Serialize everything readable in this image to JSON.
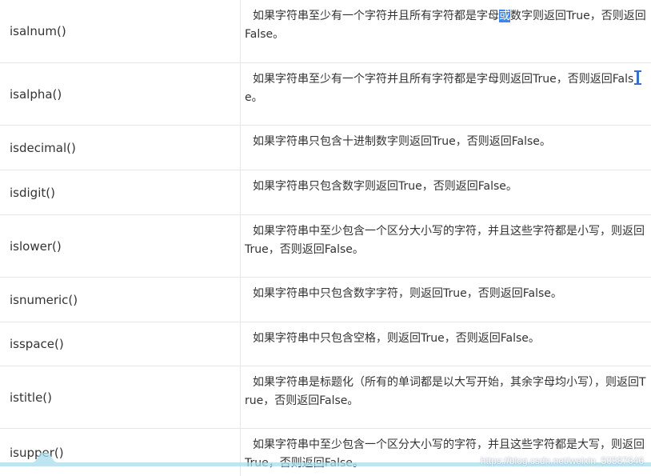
{
  "rows": [
    {
      "method": "isalnum()",
      "desc_before": "如果字符串至少有一个字符并且所有字符都是字母",
      "desc_highlight": "或",
      "desc_after": "数字则返回True，否则返回False。"
    },
    {
      "method": "isalpha()",
      "desc_before": "如果字符串至少有一个字符并且所有字符都是字母则返回True，否则返回Fals",
      "desc_after": "e。"
    },
    {
      "method": "isdecimal()",
      "desc": "如果字符串只包含十进制数字则返回True，否则返回False。"
    },
    {
      "method": "isdigit()",
      "desc": "如果字符串只包含数字则返回True，否则返回False。"
    },
    {
      "method": "islower()",
      "desc": "如果字符串中至少包含一个区分大小写的字符，并且这些字符都是小写，则返回True，否则返回False。"
    },
    {
      "method": "isnumeric()",
      "desc": "如果字符串中只包含数字字符，则返回True，否则返回False。"
    },
    {
      "method": "isspace()",
      "desc": "如果字符串中只包含空格，则返回True，否则返回False。"
    },
    {
      "method": "istitle()",
      "desc": "如果字符串是标题化（所有的单词都是以大写开始，其余字母均小写），则返回True，否则返回False。"
    },
    {
      "method": "isupper()",
      "desc": "如果字符串中至少包含一个区分大小写的字符，并且这些字符都是大写，则返回True，否则返回False。"
    }
  ],
  "watermark": "https://blog.csdn.net/weixin_50587646",
  "colors": {
    "highlight": "#3a86f0",
    "border": "#e6e6e6",
    "wave": "#a9dcef"
  }
}
